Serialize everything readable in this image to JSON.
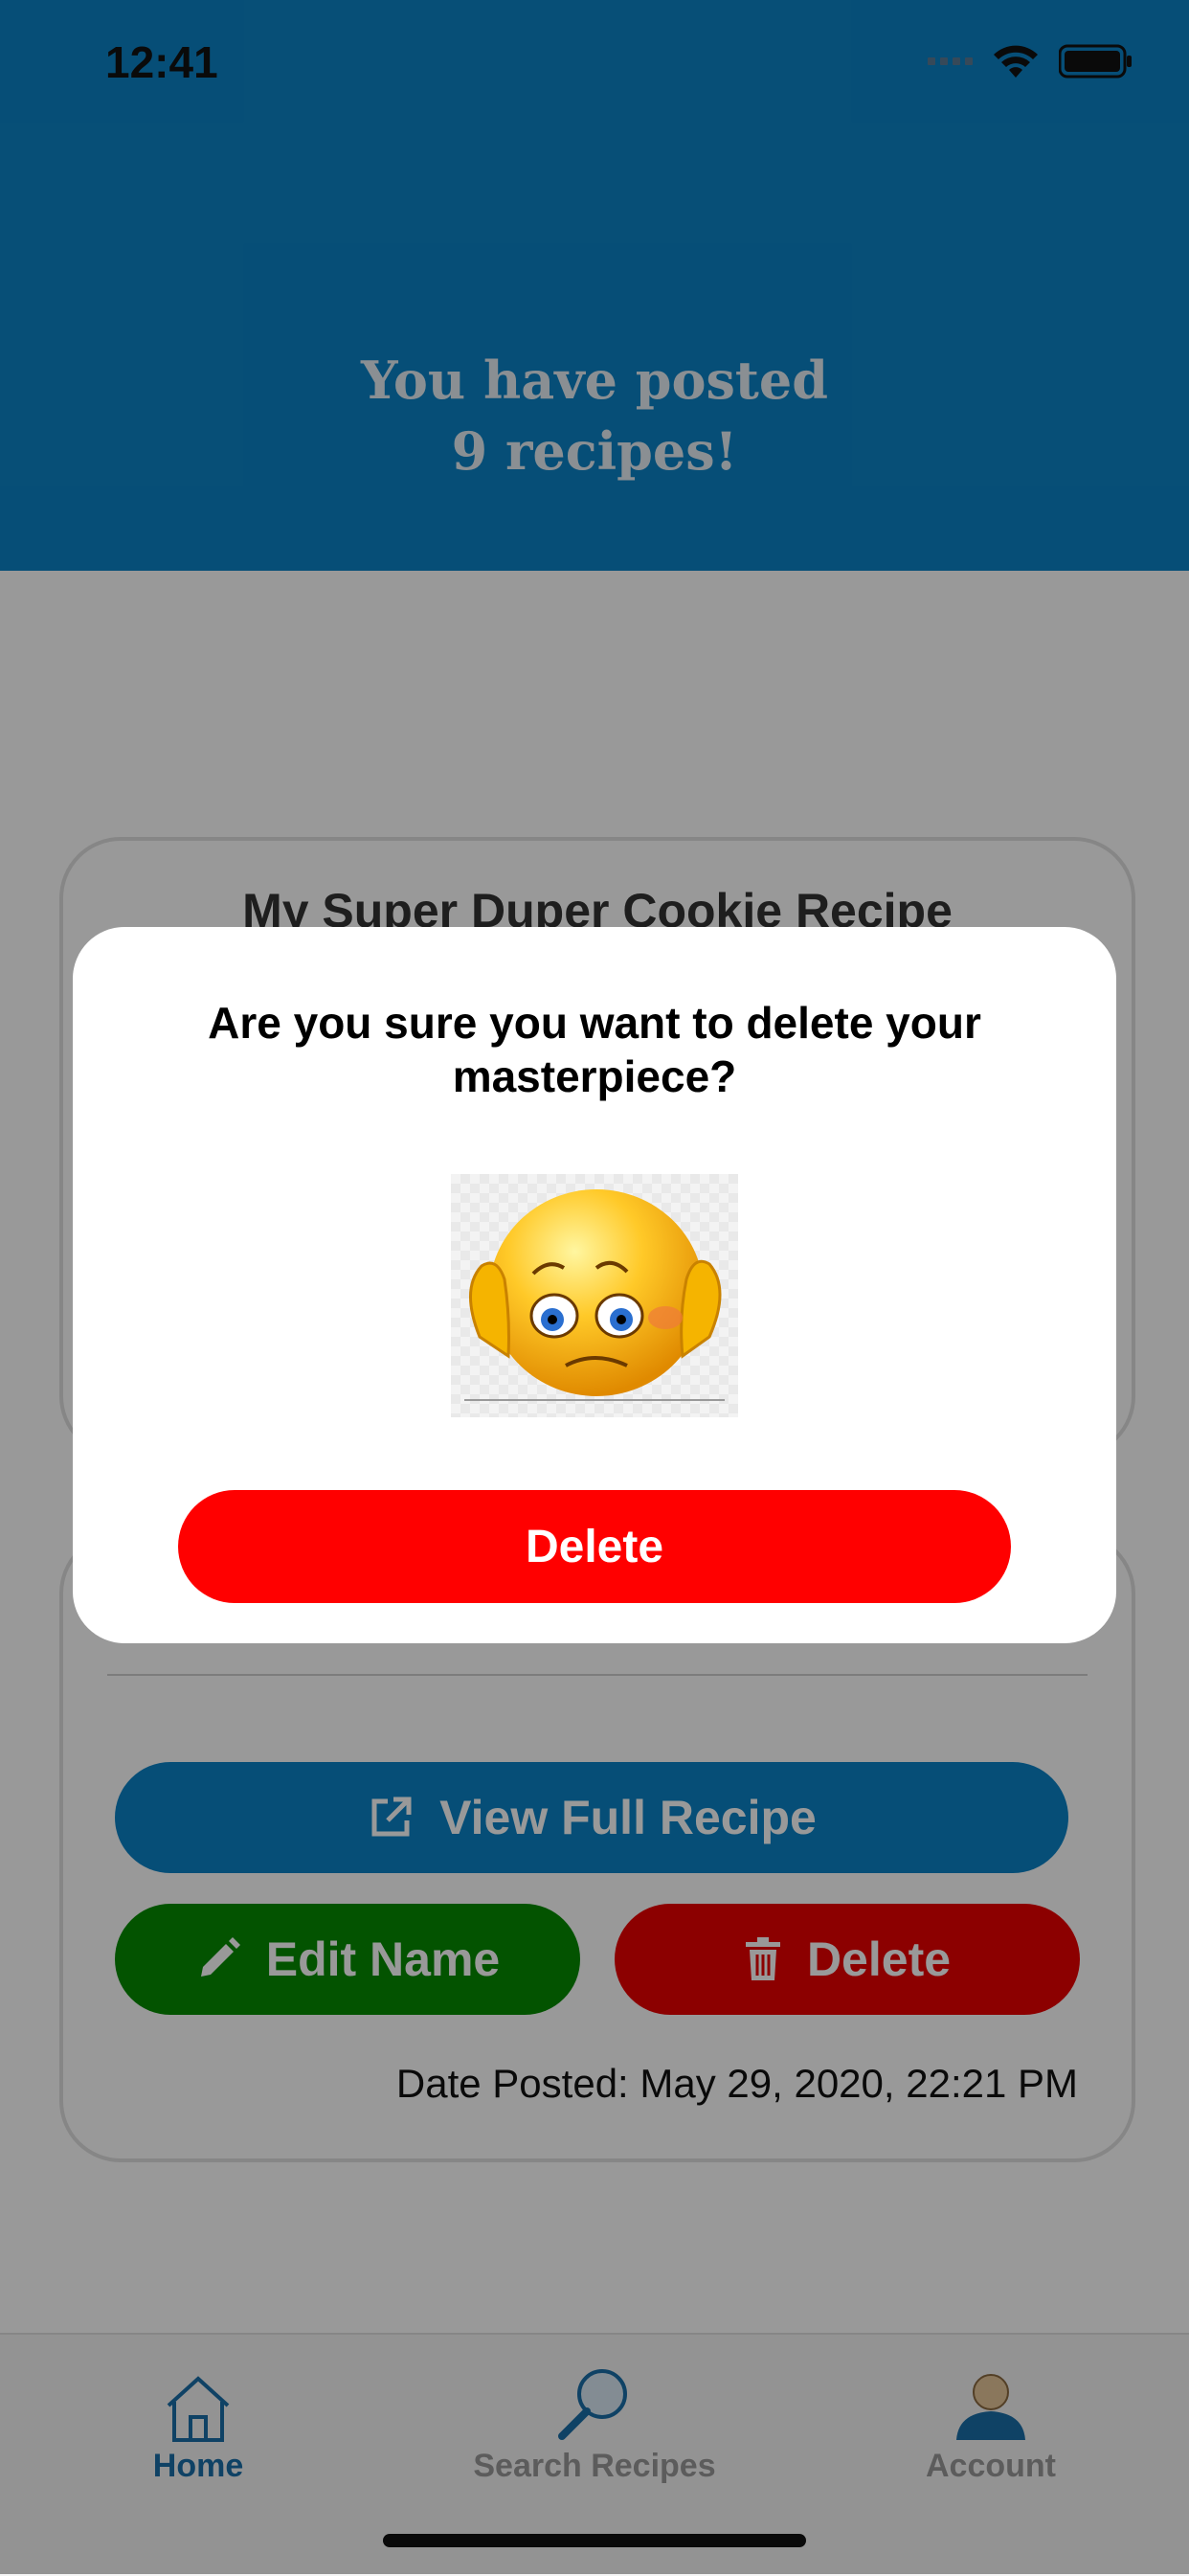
{
  "status_bar": {
    "time": "12:41"
  },
  "header": {
    "line1": "You have posted",
    "line2": "9 recipes!"
  },
  "recipe_card": {
    "title": "My Super Duper Cookie Recipe",
    "view_label": "View Full Recipe",
    "edit_label": "Edit Name",
    "delete_label": "Delete",
    "date_posted": "Date Posted: May 29, 2020, 22:21 PM"
  },
  "modal": {
    "question": "Are you sure you want to delete your masterpiece?",
    "emoji_icon": "sad-face-icon",
    "delete_label": "Delete"
  },
  "tabbar": {
    "items": [
      {
        "label": "Home",
        "icon": "home-icon",
        "active": true
      },
      {
        "label": "Search Recipes",
        "icon": "search-icon",
        "active": false
      },
      {
        "label": "Account",
        "icon": "account-icon",
        "active": false
      }
    ]
  },
  "colors": {
    "header": "#0b83c7",
    "view_button": "#0b83c7",
    "edit_button": "#068a00",
    "delete_button": "#ea0000",
    "modal_delete": "#ff0000",
    "tab_active": "#1a6ea8",
    "tab_inactive": "#9a9a9a"
  }
}
